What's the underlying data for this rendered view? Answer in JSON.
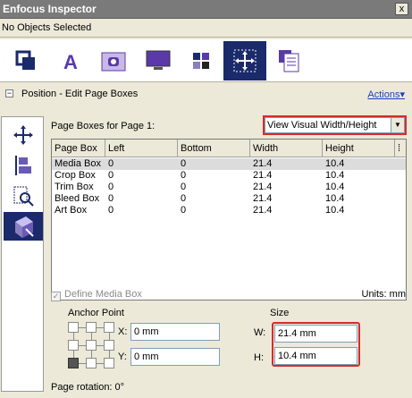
{
  "window": {
    "title": "Enfocus Inspector",
    "close_glyph": "x"
  },
  "selection_status": "No Objects Selected",
  "toolbar_icons": [
    "object-icon",
    "text-icon",
    "image-icon",
    "monitor-icon",
    "color-icon",
    "position-icon",
    "document-icon"
  ],
  "section": {
    "collapse_glyph": "−",
    "title": "Position - Edit Page Boxes",
    "actions_label": "Actions"
  },
  "page_boxes": {
    "title": "Page Boxes for Page 1:",
    "view_select": "View Visual Width/Height",
    "columns": [
      "Page Box",
      "Left",
      "Bottom",
      "Width",
      "Height"
    ],
    "rows": [
      [
        "Media Box",
        "0",
        "0",
        "21.4",
        "10.4"
      ],
      [
        "Crop Box",
        "0",
        "0",
        "21.4",
        "10.4"
      ],
      [
        "Trim Box",
        "0",
        "0",
        "21.4",
        "10.4"
      ],
      [
        "Bleed Box",
        "0",
        "0",
        "21.4",
        "10.4"
      ],
      [
        "Art Box",
        "0",
        "0",
        "21.4",
        "10.4"
      ]
    ]
  },
  "define_media_box": "Define Media Box",
  "units": "Units: mm",
  "anchor": {
    "label": "Anchor Point",
    "x_label": "X:",
    "x_value": "0 mm",
    "y_label": "Y:",
    "y_value": "0 mm"
  },
  "size": {
    "label": "Size",
    "w_label": "W:",
    "w_value": "21.4 mm",
    "h_label": "H:",
    "h_value": "10.4 mm"
  },
  "rotation": "Page rotation: 0°",
  "colors": {
    "accent": "#1b2a6b",
    "highlight": "#d62b2b",
    "link": "#1d3fbb"
  }
}
